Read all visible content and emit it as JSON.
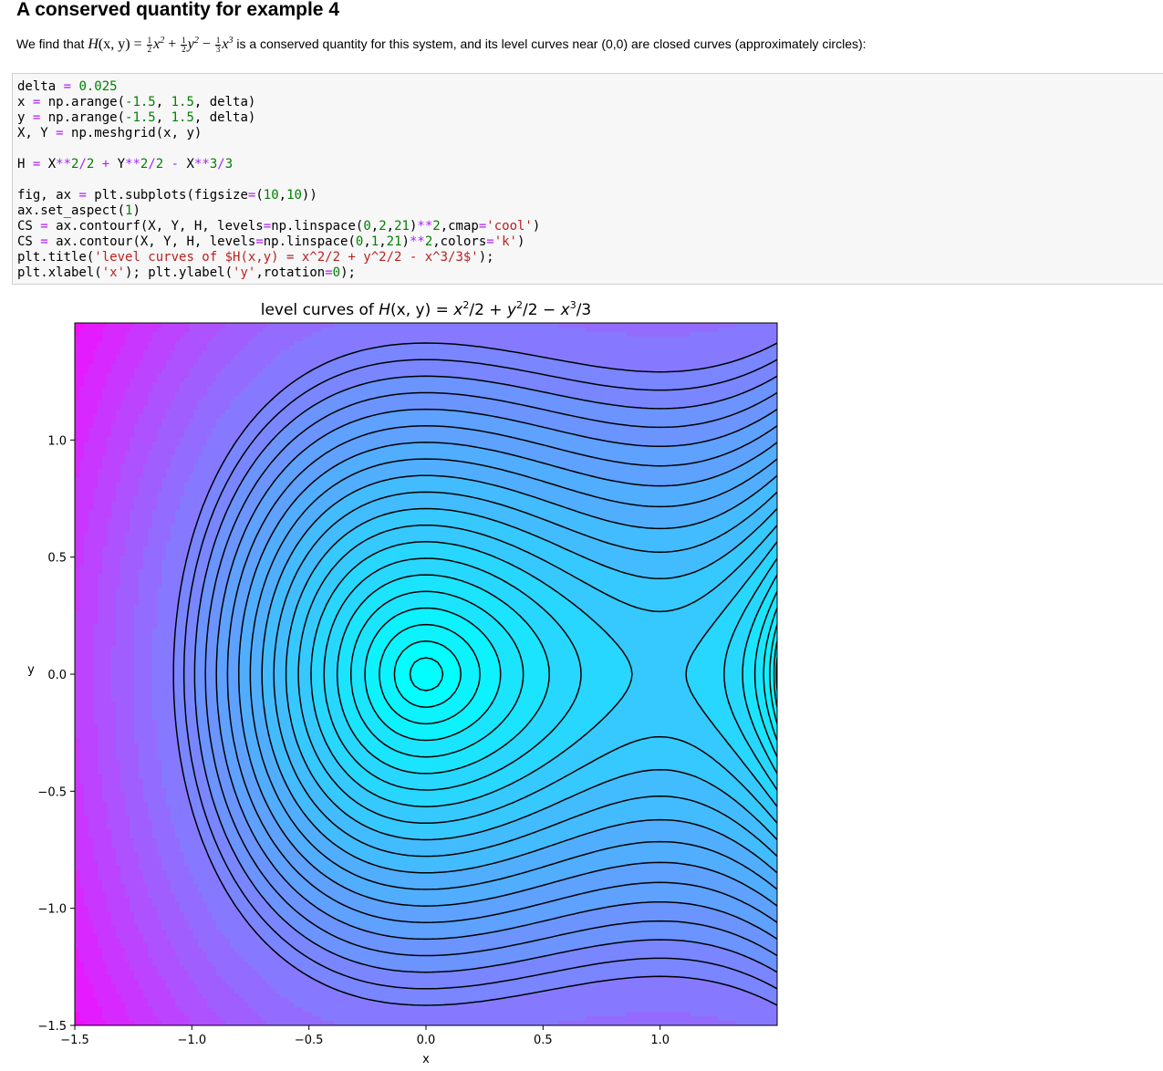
{
  "heading": "A conserved quantity for example 4",
  "paragraph": {
    "prefix": "We find that ",
    "suffix": " is a conserved quantity for this system, and its level curves near (0,0) are closed curves (approximately circles):",
    "math": {
      "H": "H",
      "args": "(x, y) = ",
      "t1_num": "1",
      "t1_den": "2",
      "t1_var": "x",
      "t1_pow": "2",
      "plus": " + ",
      "t2_num": "1",
      "t2_den": "2",
      "t2_var": "y",
      "t2_pow": "2",
      "minus": " − ",
      "t3_num": "1",
      "t3_den": "3",
      "t3_var": "x",
      "t3_pow": "3"
    }
  },
  "code_lines": [
    [
      [
        "delta ",
        ""
      ],
      [
        "=",
        "o"
      ],
      [
        " ",
        ""
      ],
      [
        "0.025",
        "n"
      ]
    ],
    [
      [
        "x ",
        ""
      ],
      [
        "=",
        "o"
      ],
      [
        " np.arange(",
        ""
      ],
      [
        "-1.5",
        "n"
      ],
      [
        ", ",
        ""
      ],
      [
        "1.5",
        "n"
      ],
      [
        ", delta)",
        ""
      ]
    ],
    [
      [
        "y ",
        ""
      ],
      [
        "=",
        "o"
      ],
      [
        " np.arange(",
        ""
      ],
      [
        "-1.5",
        "n"
      ],
      [
        ", ",
        ""
      ],
      [
        "1.5",
        "n"
      ],
      [
        ", delta)",
        ""
      ]
    ],
    [
      [
        "X, Y ",
        ""
      ],
      [
        "=",
        "o"
      ],
      [
        " np.meshgrid(x, y)",
        ""
      ]
    ],
    [],
    [
      [
        "H ",
        ""
      ],
      [
        "=",
        "o"
      ],
      [
        " X",
        ""
      ],
      [
        "**",
        "o"
      ],
      [
        "2",
        "n"
      ],
      [
        "/",
        "o"
      ],
      [
        "2",
        "n"
      ],
      [
        " ",
        ""
      ],
      [
        "+",
        "o"
      ],
      [
        " Y",
        ""
      ],
      [
        "**",
        "o"
      ],
      [
        "2",
        "n"
      ],
      [
        "/",
        "o"
      ],
      [
        "2",
        "n"
      ],
      [
        " ",
        ""
      ],
      [
        "-",
        "o"
      ],
      [
        " X",
        ""
      ],
      [
        "**",
        "o"
      ],
      [
        "3",
        "n"
      ],
      [
        "/",
        "o"
      ],
      [
        "3",
        "n"
      ]
    ],
    [],
    [
      [
        "fig, ax ",
        ""
      ],
      [
        "=",
        "o"
      ],
      [
        " plt.subplots(figsize",
        ""
      ],
      [
        "=",
        "o"
      ],
      [
        "(",
        ""
      ],
      [
        "10",
        "n"
      ],
      [
        ",",
        ""
      ],
      [
        "10",
        "n"
      ],
      [
        "))",
        ""
      ]
    ],
    [
      [
        "ax.set_aspect(",
        ""
      ],
      [
        "1",
        "n"
      ],
      [
        ")",
        ""
      ]
    ],
    [
      [
        "CS ",
        ""
      ],
      [
        "=",
        "o"
      ],
      [
        " ax.contourf(X, Y, H, levels",
        ""
      ],
      [
        "=",
        "o"
      ],
      [
        "np.linspace(",
        ""
      ],
      [
        "0",
        "n"
      ],
      [
        ",",
        ""
      ],
      [
        "2",
        "n"
      ],
      [
        ",",
        ""
      ],
      [
        "21",
        "n"
      ],
      [
        ")",
        ""
      ],
      [
        "**",
        "o"
      ],
      [
        "2",
        "n"
      ],
      [
        ",cmap",
        ""
      ],
      [
        "=",
        "o"
      ],
      [
        "'cool'",
        "s"
      ],
      [
        ")",
        ""
      ]
    ],
    [
      [
        "CS ",
        ""
      ],
      [
        "=",
        "o"
      ],
      [
        " ax.contour(X, Y, H, levels",
        ""
      ],
      [
        "=",
        "o"
      ],
      [
        "np.linspace(",
        ""
      ],
      [
        "0",
        "n"
      ],
      [
        ",",
        ""
      ],
      [
        "1",
        "n"
      ],
      [
        ",",
        ""
      ],
      [
        "21",
        "n"
      ],
      [
        ")",
        ""
      ],
      [
        "**",
        "o"
      ],
      [
        "2",
        "n"
      ],
      [
        ",colors",
        ""
      ],
      [
        "=",
        "o"
      ],
      [
        "'k'",
        "s"
      ],
      [
        ")",
        ""
      ]
    ],
    [
      [
        "plt.title(",
        ""
      ],
      [
        "'level curves of $H(x,y) = x^2/2 + y^2/2 - x^3/3$'",
        "s"
      ],
      [
        ");",
        ""
      ]
    ],
    [
      [
        "plt.xlabel(",
        ""
      ],
      [
        "'x'",
        "s"
      ],
      [
        "); plt.ylabel(",
        ""
      ],
      [
        "'y'",
        "s"
      ],
      [
        ",rotation",
        ""
      ],
      [
        "=",
        "o"
      ],
      [
        "0",
        "n"
      ],
      [
        ");",
        ""
      ]
    ]
  ],
  "chart_data": {
    "type": "contour",
    "function": "H(x,y) = x^2/2 + y^2/2 - x^3/3",
    "grid": {
      "x_start": -1.5,
      "x_stop": 1.5,
      "y_start": -1.5,
      "y_stop": 1.5,
      "delta": 0.025
    },
    "filled_levels": {
      "linspace": [
        0,
        2,
        21
      ],
      "power": 2
    },
    "line_levels": {
      "linspace": [
        0,
        1,
        21
      ],
      "power": 2
    },
    "cmap": "cool",
    "line_color": "#000000",
    "title": {
      "prefix": "level curves of ",
      "H": "H",
      "args": "(x, y) = ",
      "t1": "x",
      "p1": "2",
      "d1": "/2 + ",
      "t2": "y",
      "p2": "2",
      "d2": "/2 − ",
      "t3": "x",
      "p3": "3",
      "d3": "/3"
    },
    "xlabel": "x",
    "ylabel": "y",
    "xlim": [
      -1.5,
      1.5
    ],
    "ylim": [
      -1.5,
      1.5
    ],
    "xticks": [
      -1.5,
      -1.0,
      -0.5,
      0.0,
      0.5,
      1.0
    ],
    "xtick_labels": [
      "−1.5",
      "−1.0",
      "−0.5",
      "0.0",
      "0.5",
      "1.0"
    ],
    "yticks": [
      -1.5,
      -1.0,
      -0.5,
      0.0,
      0.5,
      1.0
    ],
    "ytick_labels": [
      "−1.5",
      "−1.0",
      "−0.5",
      "0.0",
      "0.5",
      "1.0"
    ]
  }
}
